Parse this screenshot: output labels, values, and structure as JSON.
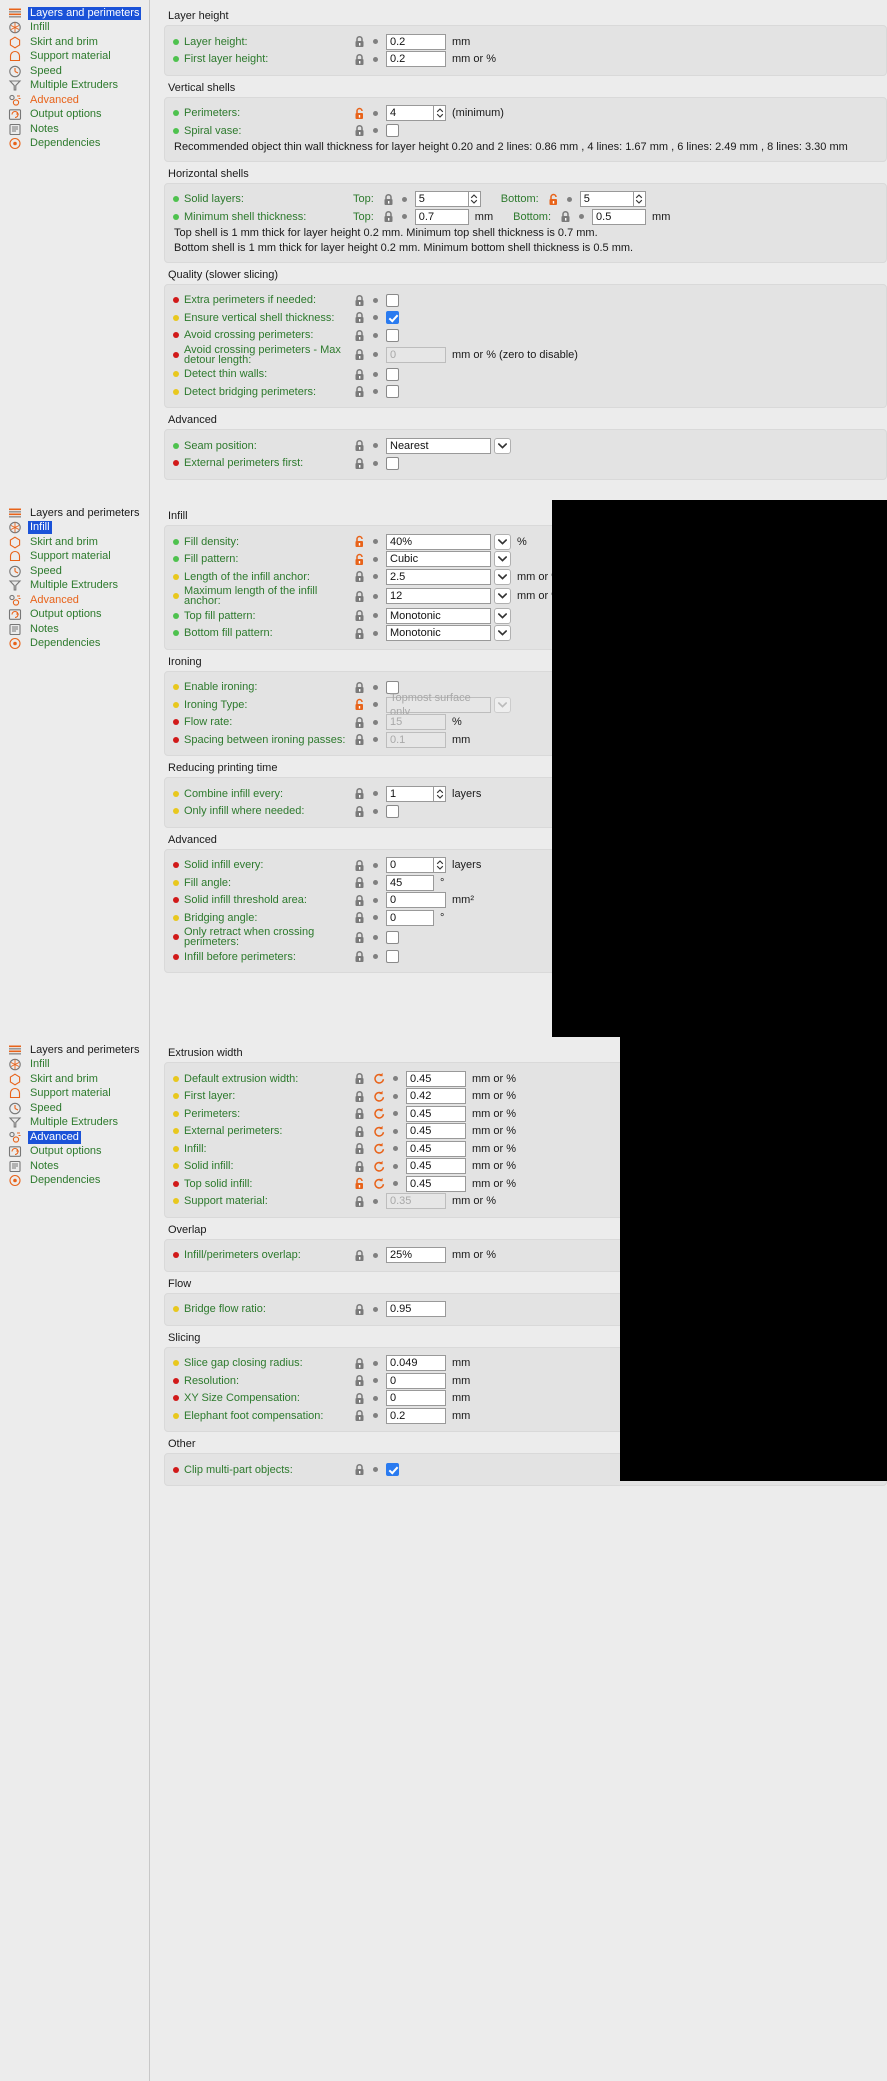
{
  "sidebar": {
    "items": [
      {
        "label": "Layers and perimeters",
        "icon": "layers-icon"
      },
      {
        "label": "Infill",
        "icon": "infill-icon"
      },
      {
        "label": "Skirt and brim",
        "icon": "skirt-icon"
      },
      {
        "label": "Support material",
        "icon": "support-icon"
      },
      {
        "label": "Speed",
        "icon": "speed-icon"
      },
      {
        "label": "Multiple Extruders",
        "icon": "extruders-icon"
      },
      {
        "label": "Advanced",
        "icon": "advanced-icon"
      },
      {
        "label": "Output options",
        "icon": "output-icon"
      },
      {
        "label": "Notes",
        "icon": "notes-icon"
      },
      {
        "label": "Dependencies",
        "icon": "dependencies-icon"
      }
    ]
  },
  "units": {
    "mm": "mm",
    "mm_or_pct": "mm or %",
    "pct": "%",
    "layers": "layers",
    "deg": "°",
    "mm2": "mm²",
    "minimum": "(minimum)",
    "zero_to_disable": "mm or % (zero to disable)"
  },
  "panel1": {
    "groups": [
      {
        "title": "Layer height",
        "rows": [
          {
            "label": "Layer height:",
            "dot": "green",
            "lock": "locked",
            "value": "0.2",
            "unit": "mm"
          },
          {
            "label": "First layer height:",
            "dot": "green",
            "lock": "locked",
            "value": "0.2",
            "unit": "mm or %"
          }
        ]
      },
      {
        "title": "Vertical shells",
        "rows": [
          {
            "label": "Perimeters:",
            "dot": "green",
            "lock": "unlocked",
            "value": "4",
            "unit": "(minimum)",
            "spinner": true
          },
          {
            "label": "Spiral vase:",
            "dot": "green",
            "lock": "locked",
            "checkbox": false
          }
        ],
        "note": "Recommended object thin wall thickness for layer height 0.20 and 2 lines: 0.86 mm , 4 lines: 1.67 mm , 6 lines: 2.49 mm , 8 lines: 3.30 mm"
      },
      {
        "title": "Horizontal shells",
        "rows": [
          {
            "label": "Solid layers:",
            "dot": "green",
            "top_label": "Top:",
            "top_value": "5",
            "bottom_label": "Bottom:",
            "bottom_value": "5",
            "top_lock": "locked",
            "bottom_lock": "unlocked"
          },
          {
            "label": "Minimum shell thickness:",
            "dot": "green",
            "top_label": "Top:",
            "top_value": "0.7",
            "bottom_label": "Bottom:",
            "bottom_value": "0.5",
            "unit": "mm"
          }
        ],
        "note": "Top shell is 1 mm thick for layer height 0.2 mm. Minimum top shell thickness is 0.7 mm.\nBottom shell is 1 mm thick for layer height 0.2 mm. Minimum bottom shell thickness is 0.5 mm."
      },
      {
        "title": "Quality (slower slicing)",
        "rows": [
          {
            "label": "Extra perimeters if needed:",
            "dot": "red",
            "lock": "locked",
            "checkbox": false
          },
          {
            "label": "Ensure vertical shell thickness:",
            "dot": "yellow",
            "lock": "locked",
            "checkbox": true
          },
          {
            "label": "Avoid crossing perimeters:",
            "dot": "red",
            "lock": "locked",
            "checkbox": false
          },
          {
            "label": "Avoid crossing perimeters - Max detour length:",
            "dot": "red",
            "lock": "locked",
            "value": "0",
            "unit": "mm or % (zero to disable)",
            "disabled": true
          },
          {
            "label": "Detect thin walls:",
            "dot": "yellow",
            "lock": "locked",
            "checkbox": false
          },
          {
            "label": "Detect bridging perimeters:",
            "dot": "yellow",
            "lock": "locked",
            "checkbox": false
          }
        ]
      },
      {
        "title": "Advanced",
        "rows": [
          {
            "label": "Seam position:",
            "dot": "green",
            "lock": "locked",
            "value": "Nearest",
            "combo": true
          },
          {
            "label": "External perimeters first:",
            "dot": "red",
            "lock": "locked",
            "checkbox": false
          }
        ]
      }
    ]
  },
  "panel2": {
    "groups": [
      {
        "title": "Infill",
        "rows": [
          {
            "label": "Fill density:",
            "dot": "green",
            "lock": "unlocked",
            "value": "40%",
            "combo": true,
            "unit": "%"
          },
          {
            "label": "Fill pattern:",
            "dot": "green",
            "lock": "unlocked",
            "value": "Cubic",
            "combo": true
          },
          {
            "label": "Length of the infill anchor:",
            "dot": "yellow",
            "lock": "locked",
            "value": "2.5",
            "combo": true,
            "unit": "mm or %"
          },
          {
            "label": "Maximum length of the infill anchor:",
            "dot": "yellow",
            "lock": "locked",
            "value": "12",
            "combo": true,
            "unit": "mm or %"
          },
          {
            "label": "Top fill pattern:",
            "dot": "green",
            "lock": "locked",
            "value": "Monotonic",
            "combo": true
          },
          {
            "label": "Bottom fill pattern:",
            "dot": "green",
            "lock": "locked",
            "value": "Monotonic",
            "combo": true
          }
        ]
      },
      {
        "title": "Ironing",
        "rows": [
          {
            "label": "Enable ironing:",
            "dot": "yellow",
            "lock": "locked",
            "checkbox": false
          },
          {
            "label": "Ironing Type:",
            "dot": "yellow",
            "lock": "unlocked",
            "value": "Topmost surface only",
            "combo": true,
            "disabled": true
          },
          {
            "label": "Flow rate:",
            "dot": "red",
            "lock": "locked",
            "value": "15",
            "unit": "%",
            "disabled": true
          },
          {
            "label": "Spacing between ironing passes:",
            "dot": "red",
            "lock": "locked",
            "value": "0.1",
            "unit": "mm",
            "disabled": true
          }
        ]
      },
      {
        "title": "Reducing printing time",
        "rows": [
          {
            "label": "Combine infill every:",
            "dot": "yellow",
            "lock": "locked",
            "value": "1",
            "unit": "layers",
            "spinner": true
          },
          {
            "label": "Only infill where needed:",
            "dot": "yellow",
            "lock": "locked",
            "checkbox": false
          }
        ]
      },
      {
        "title": "Advanced",
        "rows": [
          {
            "label": "Solid infill every:",
            "dot": "red",
            "lock": "locked",
            "value": "0",
            "unit": "layers",
            "spinner": true
          },
          {
            "label": "Fill angle:",
            "dot": "yellow",
            "lock": "locked",
            "value": "45",
            "unit": "°"
          },
          {
            "label": "Solid infill threshold area:",
            "dot": "red",
            "lock": "locked",
            "value": "0",
            "unit": "mm²"
          },
          {
            "label": "Bridging angle:",
            "dot": "yellow",
            "lock": "locked",
            "value": "0",
            "unit": "°"
          },
          {
            "label": "Only retract when crossing perimeters:",
            "dot": "red",
            "lock": "locked",
            "checkbox": false
          },
          {
            "label": "Infill before perimeters:",
            "dot": "red",
            "lock": "locked",
            "checkbox": false
          }
        ]
      }
    ]
  },
  "panel3": {
    "groups": [
      {
        "title": "Extrusion width",
        "rows": [
          {
            "label": "Default extrusion width:",
            "dot": "yellow",
            "lock": "locked",
            "reset": true,
            "value": "0.45",
            "unit": "mm or %"
          },
          {
            "label": "First layer:",
            "dot": "yellow",
            "lock": "locked",
            "reset": true,
            "value": "0.42",
            "unit": "mm or %"
          },
          {
            "label": "Perimeters:",
            "dot": "yellow",
            "lock": "locked",
            "reset": true,
            "value": "0.45",
            "unit": "mm or %"
          },
          {
            "label": "External perimeters:",
            "dot": "yellow",
            "lock": "locked",
            "reset": true,
            "value": "0.45",
            "unit": "mm or %"
          },
          {
            "label": "Infill:",
            "dot": "yellow",
            "lock": "locked",
            "reset": true,
            "value": "0.45",
            "unit": "mm or %"
          },
          {
            "label": "Solid infill:",
            "dot": "yellow",
            "lock": "locked",
            "reset": true,
            "value": "0.45",
            "unit": "mm or %"
          },
          {
            "label": "Top solid infill:",
            "dot": "red",
            "lock": "unlocked",
            "reset": true,
            "value": "0.45",
            "unit": "mm or %"
          },
          {
            "label": "Support material:",
            "dot": "yellow",
            "lock": "locked",
            "value": "0.35",
            "unit": "mm or %",
            "disabled": true
          }
        ]
      },
      {
        "title": "Overlap",
        "rows": [
          {
            "label": "Infill/perimeters overlap:",
            "dot": "red",
            "lock": "locked",
            "value": "25%",
            "unit": "mm or %"
          }
        ]
      },
      {
        "title": "Flow",
        "rows": [
          {
            "label": "Bridge flow ratio:",
            "dot": "yellow",
            "lock": "locked",
            "value": "0.95"
          }
        ]
      },
      {
        "title": "Slicing",
        "rows": [
          {
            "label": "Slice gap closing radius:",
            "dot": "yellow",
            "lock": "locked",
            "value": "0.049",
            "unit": "mm"
          },
          {
            "label": "Resolution:",
            "dot": "red",
            "lock": "locked",
            "value": "0",
            "unit": "mm"
          },
          {
            "label": "XY Size Compensation:",
            "dot": "red",
            "lock": "locked",
            "value": "0",
            "unit": "mm"
          },
          {
            "label": "Elephant foot compensation:",
            "dot": "yellow",
            "lock": "locked",
            "value": "0.2",
            "unit": "mm"
          }
        ]
      },
      {
        "title": "Other",
        "rows": [
          {
            "label": "Clip multi-part objects:",
            "dot": "red",
            "lock": "locked",
            "checkbox": true
          }
        ]
      }
    ]
  },
  "colors": {
    "selection_blue": "#1a52d8",
    "label_green": "#2d7a2d",
    "modified_orange": "#e8631a",
    "dot_green": "#4ec24e",
    "dot_yellow": "#e8c81e",
    "dot_red": "#d11a1a",
    "checkbox_blue": "#2a7bf0",
    "panel_bg": "#ececec",
    "group_bg": "#e3e3e3"
  }
}
